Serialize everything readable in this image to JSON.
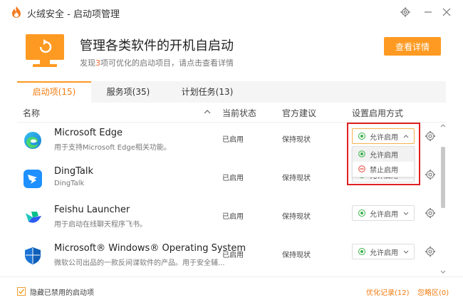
{
  "window": {
    "title": "火绒安全 - 启动项管理",
    "colors": {
      "accent": "#fe9a22",
      "active_tab": "#f07d10",
      "enabled_green": "#38b349",
      "disabled_red": "#e34b3c",
      "highlight": "#e02020"
    }
  },
  "banner": {
    "heading": "管理各类软件的开机自启动",
    "sub_prefix": "发现",
    "sub_count": "3",
    "sub_suffix": "项可优化的启动项目，请点击查看详情",
    "details_button": "查看详情"
  },
  "tabs": [
    {
      "label": "启动项(15)",
      "active": true
    },
    {
      "label": "服务项(35)",
      "active": false
    },
    {
      "label": "计划任务(13)",
      "active": false
    }
  ],
  "table": {
    "headers": {
      "name": "名称",
      "status": "当前状态",
      "advice": "官方建议",
      "method": "设置启用方式"
    },
    "rows": [
      {
        "name": "Microsoft Edge",
        "desc": "用于支持Microsoft Edge相关功能。",
        "status": "已启用",
        "advice": "保持现状",
        "method": "允许启用",
        "icon": "edge-icon"
      },
      {
        "name": "DingTalk",
        "desc": "DingTalk",
        "status": "已启用",
        "advice": "保持现状",
        "method": "允许启用",
        "icon": "dingtalk-icon"
      },
      {
        "name": "Feishu Launcher",
        "desc": "用于启动在线聊天程序飞书。",
        "status": "已启用",
        "advice": "保持现状",
        "method": "允许启用",
        "icon": "feishu-icon"
      },
      {
        "name": "Microsoft® Windows® Operating System",
        "desc": "微软公司出品的一款反间谍软件的产品。用于安全辅...",
        "status": "已启用",
        "advice": "保持现状",
        "method": "允许启用",
        "icon": "windows-defender-icon"
      }
    ]
  },
  "dropdown": {
    "options": [
      {
        "label": "允许启用",
        "icon": "allow-icon",
        "selected": true
      },
      {
        "label": "禁止启用",
        "icon": "forbid-icon",
        "selected": false
      }
    ]
  },
  "footer": {
    "hide_disabled_label": "隐藏已禁用的启动项",
    "hide_disabled_checked": true,
    "opt_records": "优化记录(12)",
    "ignore_zone": "忽略区(0)"
  }
}
